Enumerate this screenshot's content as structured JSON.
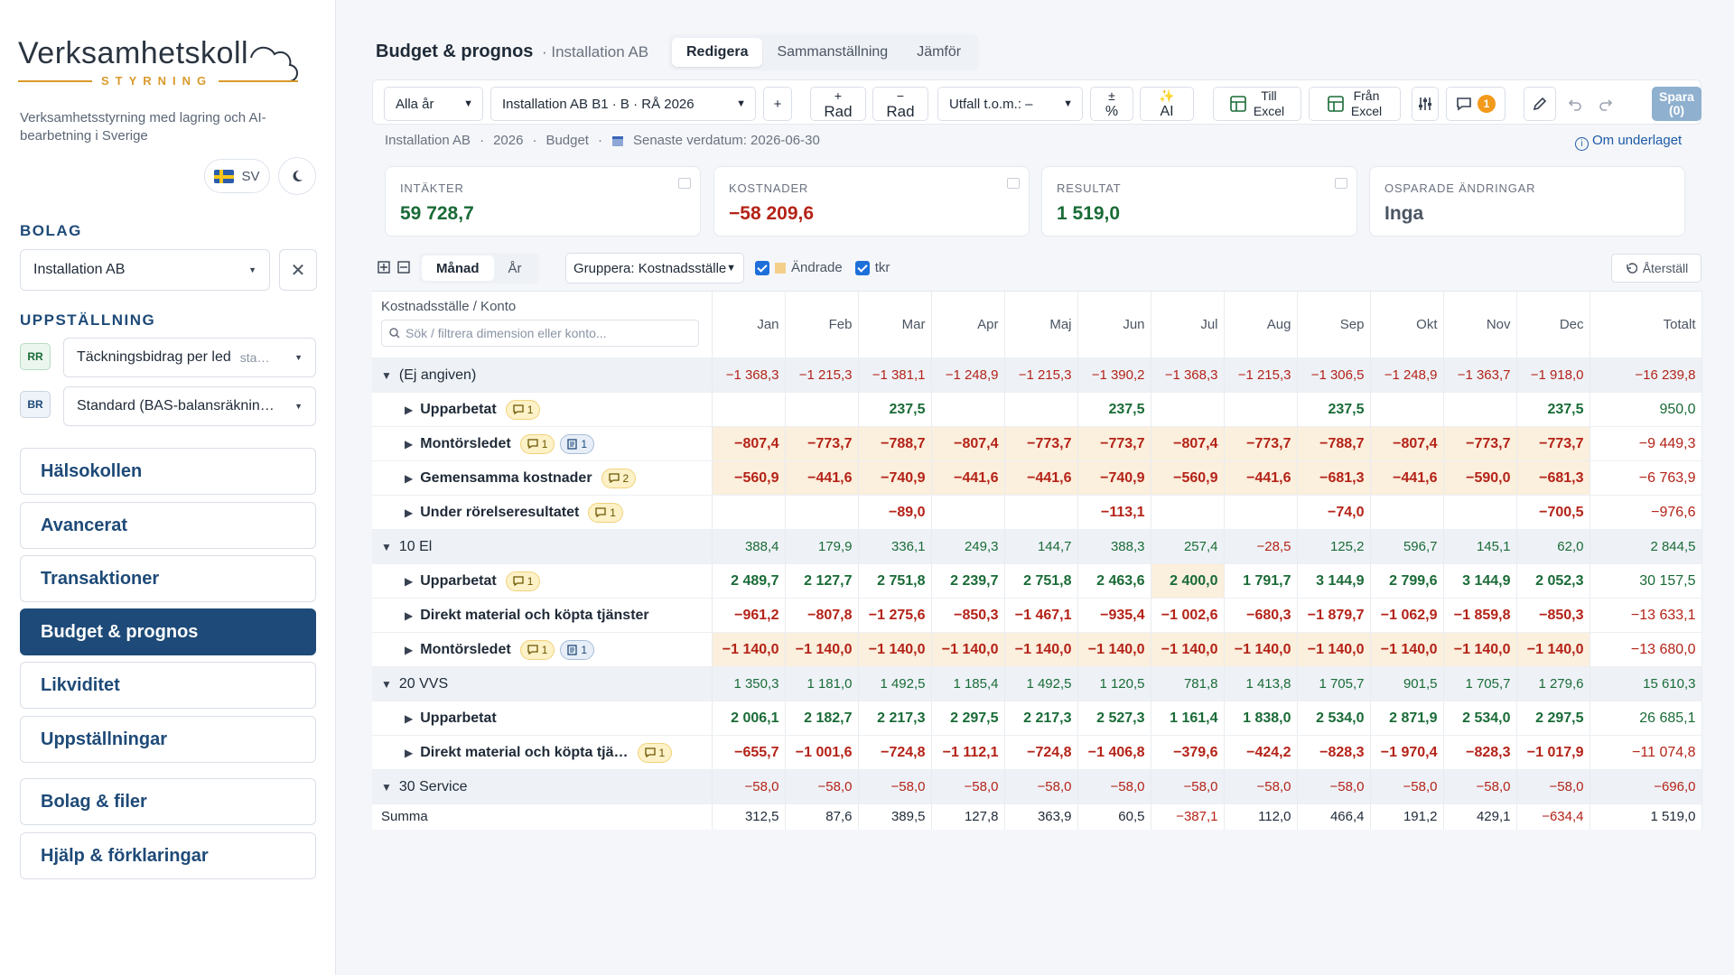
{
  "app": {
    "logo_title": "Verksamhetskoll",
    "logo_subtitle": "STYRNING",
    "tagline": "Verksamhetsstyrning med lagring och AI-bearbetning i Sverige",
    "lang": "SV"
  },
  "sidebar": {
    "bolag_label": "BOLAG",
    "bolag_value": "Installation AB",
    "uppst_label": "UPPSTÄLLNING",
    "rr_tag": "RR",
    "rr_value": "Täckningsbidrag per led",
    "rr_suffix": "sta…",
    "br_tag": "BR",
    "br_value": "Standard (BAS-balansräknin…",
    "nav": [
      "Hälsokollen",
      "Avancerat",
      "Transaktioner",
      "Budget & prognos",
      "Likviditet",
      "Uppställningar",
      "Bolag & filer",
      "Hjälp & förklaringar"
    ]
  },
  "page": {
    "title": "Budget & prognos",
    "subtitle": "· Installation AB",
    "tabs": [
      "Redigera",
      "Sammanställning",
      "Jämför"
    ]
  },
  "toolbar": {
    "year": "Alla år",
    "scenario": "Installation AB B1 · B · RÅ 2026",
    "plus": "+",
    "add_row": [
      "+",
      "Rad"
    ],
    "del_row": [
      "−",
      "Rad"
    ],
    "utfall": "Utfall t.o.m.: –",
    "pct": [
      "±",
      "%"
    ],
    "ai": [
      "✨",
      "AI"
    ],
    "to_excel": [
      "Till",
      "Excel"
    ],
    "from_excel": [
      "Från",
      "Excel"
    ],
    "comments_count": "1",
    "save": "Spara",
    "save_sub": "(0)"
  },
  "meta": {
    "company": "Installation AB",
    "year": "2026",
    "type": "Budget",
    "latest": "Senaste verdatum: 2026-06-30",
    "about": "Om underlaget"
  },
  "kpis": [
    {
      "label": "INTÄKTER",
      "value": "59 728,7",
      "color": "#1a6b37"
    },
    {
      "label": "KOSTNADER",
      "value": "−58 209,6",
      "color": "#b42318"
    },
    {
      "label": "RESULTAT",
      "value": "1 519,0",
      "color": "#1a6b37"
    },
    {
      "label": "OSPARADE ÄNDRINGAR",
      "value": "Inga",
      "color": "#4b5563"
    }
  ],
  "controls": {
    "period_tabs": [
      "Månad",
      "År"
    ],
    "group_by": "Gruppera: Kostnadsställe",
    "changed": "Ändrade",
    "tkr": "tkr",
    "reset": "Återställ"
  },
  "grid": {
    "dim_header": "Kostnadsställe / Konto",
    "search_placeholder": "Sök / filtrera dimension eller konto...",
    "months": [
      "Jan",
      "Feb",
      "Mar",
      "Apr",
      "Maj",
      "Jun",
      "Jul",
      "Aug",
      "Sep",
      "Okt",
      "Nov",
      "Dec"
    ],
    "total_header": "Totalt",
    "rows": [
      {
        "kind": "group",
        "label": "(Ej angiven)",
        "values": [
          "−1 368,3",
          "−1 215,3",
          "−1 381,1",
          "−1 248,9",
          "−1 215,3",
          "−1 390,2",
          "−1 368,3",
          "−1 215,3",
          "−1 306,5",
          "−1 248,9",
          "−1 363,7",
          "−1 918,0"
        ],
        "total": "−16 239,8",
        "hl": true
      },
      {
        "kind": "sub",
        "label": "Upparbetat",
        "comments": "1",
        "values": [
          "",
          "",
          "237,5",
          "",
          "",
          "237,5",
          "",
          "",
          "237,5",
          "",
          "",
          "237,5"
        ],
        "total": "950,0",
        "hl": false
      },
      {
        "kind": "sub",
        "label": "Montörsledet",
        "comments": "1",
        "notes": "1",
        "values": [
          "−807,4",
          "−773,7",
          "−788,7",
          "−807,4",
          "−773,7",
          "−773,7",
          "−807,4",
          "−773,7",
          "−788,7",
          "−807,4",
          "−773,7",
          "−773,7"
        ],
        "total": "−9 449,3",
        "hl": true
      },
      {
        "kind": "sub",
        "label": "Gemensamma kostnader",
        "comments": "2",
        "values": [
          "−560,9",
          "−441,6",
          "−740,9",
          "−441,6",
          "−441,6",
          "−740,9",
          "−560,9",
          "−441,6",
          "−681,3",
          "−441,6",
          "−590,0",
          "−681,3"
        ],
        "total": "−6 763,9",
        "hl": true
      },
      {
        "kind": "sub",
        "label": "Under rörelseresultatet",
        "comments": "1",
        "values": [
          "",
          "",
          "−89,0",
          "",
          "",
          "−113,1",
          "",
          "",
          "−74,0",
          "",
          "",
          "−700,5"
        ],
        "total": "−976,6",
        "hl": false
      },
      {
        "kind": "group",
        "label": "10 El",
        "values": [
          "388,4",
          "179,9",
          "336,1",
          "249,3",
          "144,7",
          "388,3",
          "257,4",
          "−28,5",
          "125,2",
          "596,7",
          "145,1",
          "62,0"
        ],
        "total": "2 844,5",
        "hl": true
      },
      {
        "kind": "sub",
        "label": "Upparbetat",
        "comments": "1",
        "values": [
          "2 489,7",
          "2 127,7",
          "2 751,8",
          "2 239,7",
          "2 751,8",
          "2 463,6",
          "2 400,0",
          "1 791,7",
          "3 144,9",
          "2 799,6",
          "3 144,9",
          "2 052,3"
        ],
        "total": "30 157,5",
        "hl": false,
        "hlcols": [
          6
        ]
      },
      {
        "kind": "sub",
        "label": "Direkt material och köpta tjänster",
        "values": [
          "−961,2",
          "−807,8",
          "−1 275,6",
          "−850,3",
          "−1 467,1",
          "−935,4",
          "−1 002,6",
          "−680,3",
          "−1 879,7",
          "−1 062,9",
          "−1 859,8",
          "−850,3"
        ],
        "total": "−13 633,1",
        "hl": false
      },
      {
        "kind": "sub",
        "label": "Montörsledet",
        "comments": "1",
        "notes": "1",
        "values": [
          "−1 140,0",
          "−1 140,0",
          "−1 140,0",
          "−1 140,0",
          "−1 140,0",
          "−1 140,0",
          "−1 140,0",
          "−1 140,0",
          "−1 140,0",
          "−1 140,0",
          "−1 140,0",
          "−1 140,0"
        ],
        "total": "−13 680,0",
        "hl": true
      },
      {
        "kind": "group",
        "label": "20 VVS",
        "values": [
          "1 350,3",
          "1 181,0",
          "1 492,5",
          "1 185,4",
          "1 492,5",
          "1 120,5",
          "781,8",
          "1 413,8",
          "1 705,7",
          "901,5",
          "1 705,7",
          "1 279,6"
        ],
        "total": "15 610,3",
        "hl": false
      },
      {
        "kind": "sub",
        "label": "Upparbetat",
        "values": [
          "2 006,1",
          "2 182,7",
          "2 217,3",
          "2 297,5",
          "2 217,3",
          "2 527,3",
          "1 161,4",
          "1 838,0",
          "2 534,0",
          "2 871,9",
          "2 534,0",
          "2 297,5"
        ],
        "total": "26 685,1",
        "hl": false
      },
      {
        "kind": "sub",
        "label": "Direkt material och köpta tjä…",
        "comments": "1",
        "values": [
          "−655,7",
          "−1 001,6",
          "−724,8",
          "−1 112,1",
          "−724,8",
          "−1 406,8",
          "−379,6",
          "−424,2",
          "−828,3",
          "−1 970,4",
          "−828,3",
          "−1 017,9"
        ],
        "total": "−11 074,8",
        "hl": false
      },
      {
        "kind": "group",
        "label": "30 Service",
        "values": [
          "−58,0",
          "−58,0",
          "−58,0",
          "−58,0",
          "−58,0",
          "−58,0",
          "−58,0",
          "−58,0",
          "−58,0",
          "−58,0",
          "−58,0",
          "−58,0"
        ],
        "total": "−696,0",
        "hl": true
      },
      {
        "kind": "sum",
        "label": "Summa",
        "values": [
          "312,5",
          "87,6",
          "389,5",
          "127,8",
          "363,9",
          "60,5",
          "−387,1",
          "112,0",
          "466,4",
          "191,2",
          "429,1",
          "−634,4"
        ],
        "total": "1 519,0",
        "hl": false
      }
    ]
  }
}
